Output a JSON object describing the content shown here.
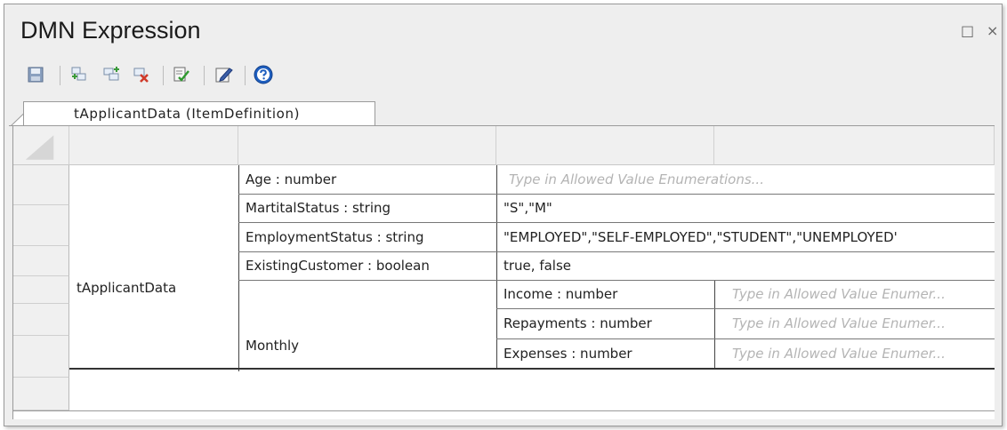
{
  "window": {
    "title": "DMN Expression",
    "maximize_icon": "□",
    "close_icon": "×"
  },
  "toolbar": {
    "icons": [
      "save-icon",
      "add-row-icon",
      "insert-row-icon",
      "delete-row-icon",
      "validate-icon",
      "edit-icon",
      "help-icon"
    ]
  },
  "tab": {
    "label": "tApplicantData (ItemDefinition)"
  },
  "table": {
    "root_label": "tApplicantData",
    "rows": [
      {
        "name": "Age : number",
        "value": "",
        "placeholder": "Type in Allowed Value Enumerations..."
      },
      {
        "name": "MartitalStatus : string",
        "value": "\"S\",\"M\""
      },
      {
        "name": "EmploymentStatus : string",
        "value": "\"EMPLOYED\",\"SELF-EMPLOYED\",\"STUDENT\",\"UNEMPLOYED'"
      },
      {
        "name": "ExistingCustomer : boolean",
        "value": "true, false"
      }
    ],
    "group": {
      "label": "Monthly",
      "rows": [
        {
          "name": "Income : number",
          "placeholder": "Type in Allowed Value Enumer..."
        },
        {
          "name": "Repayments : number",
          "placeholder": "Type in Allowed Value Enumer..."
        },
        {
          "name": "Expenses : number",
          "placeholder": "Type in Allowed Value Enumer..."
        }
      ]
    }
  }
}
